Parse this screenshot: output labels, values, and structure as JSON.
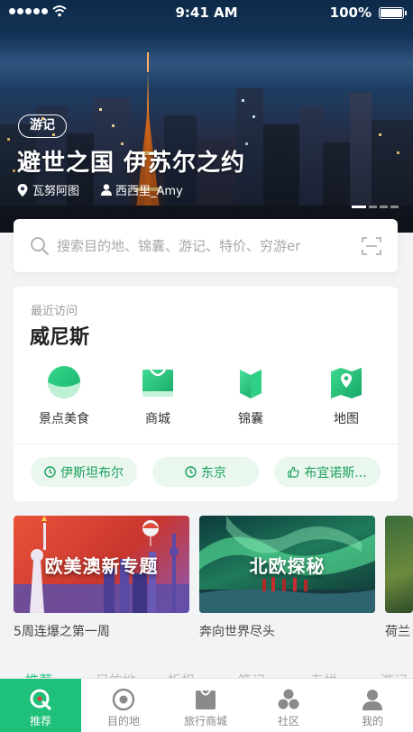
{
  "status_bar": {
    "time": "9:41 AM",
    "battery": "100%"
  },
  "hero": {
    "tag": "游记",
    "title": "避世之国 伊苏尔之约",
    "location": "瓦努阿图",
    "author": "西西里_Amy",
    "slides": 4,
    "active_slide": 1
  },
  "search": {
    "placeholder": "搜索目的地、锦囊、游记、特价、穷游er"
  },
  "recent": {
    "eyebrow": "最近访问",
    "city": "威尼斯",
    "quick_links": [
      {
        "label": "景点美食",
        "icon": "sight-food-icon"
      },
      {
        "label": "商城",
        "icon": "mall-bag-icon"
      },
      {
        "label": "锦囊",
        "icon": "guidebook-icon"
      },
      {
        "label": "地图",
        "icon": "map-pin-icon"
      }
    ],
    "history": [
      {
        "label": "伊斯坦布尔",
        "icon": "clock-icon"
      },
      {
        "label": "东京",
        "icon": "clock-icon"
      },
      {
        "label": "布宜诺斯...",
        "icon": "thumbs-up-icon"
      }
    ]
  },
  "topics": [
    {
      "title": "欧美澳新专题",
      "caption": "5周连爆之第一周"
    },
    {
      "title": "北欧探秘",
      "caption": "奔向世界尽头"
    },
    {
      "title": "",
      "caption": "荷兰"
    }
  ],
  "feed_tabs": [
    "推荐",
    "目的地",
    "折扣",
    "笔记",
    "专栏",
    "游记"
  ],
  "bottom_nav": [
    {
      "label": "推荐",
      "icon": "recommend-icon",
      "active": true
    },
    {
      "label": "目的地",
      "icon": "destination-icon",
      "active": false
    },
    {
      "label": "旅行商城",
      "icon": "shop-bag-icon",
      "active": false
    },
    {
      "label": "社区",
      "icon": "community-icon",
      "active": false
    },
    {
      "label": "我的",
      "icon": "profile-icon",
      "active": false
    }
  ],
  "colors": {
    "accent": "#1fc07a",
    "chip_bg": "#e9f7ef",
    "chip_text": "#1c9f5c"
  }
}
